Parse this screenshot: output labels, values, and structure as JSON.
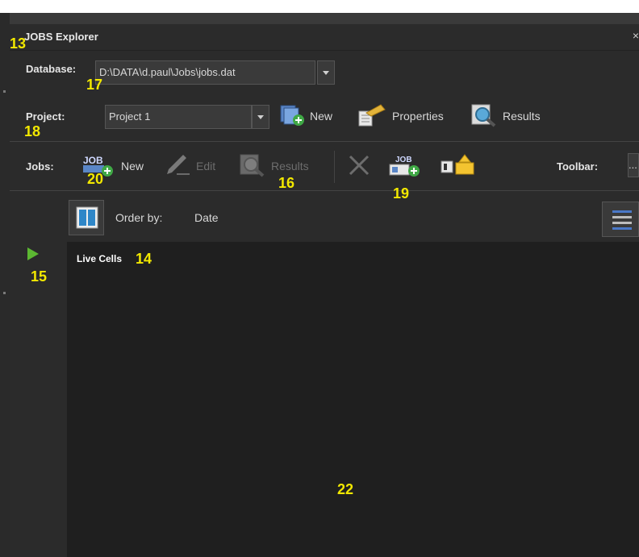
{
  "panel": {
    "title": "JOBS Explorer",
    "close_glyph": "×"
  },
  "database": {
    "label": "Database:",
    "value": "D:\\DATA\\d.paul\\Jobs\\jobs.dat"
  },
  "project": {
    "label": "Project:",
    "value": "Project 1",
    "new_label": "New",
    "properties_label": "Properties",
    "results_label": "Results"
  },
  "jobs": {
    "label": "Jobs:",
    "new_label": "New",
    "edit_label": "Edit",
    "results_label": "Results",
    "toolbar_label": "Toolbar:",
    "toolbar_value": "..."
  },
  "order": {
    "label": "Order by:",
    "value": "Date"
  },
  "tree": {
    "item_label": "Live Cells"
  },
  "annotations": {
    "a13": "13",
    "a17": "17",
    "a18": "18",
    "a20": "20",
    "a16": "16",
    "a19": "19",
    "a15": "15",
    "a14": "14",
    "a22": "22"
  },
  "icons": {
    "new_project": "document-plus-icon",
    "properties": "properties-icon",
    "results": "magnifier-icon",
    "job_new": "job-plus-icon",
    "edit": "pencil-icon",
    "delete": "close-x-icon",
    "job_group_add": "job-group-plus-icon",
    "export": "export-icon",
    "order_toggle": "columns-icon",
    "expand": "play-arrow-icon"
  },
  "colors": {
    "panel_bg": "#2b2b2b",
    "content_bg": "#1f1f1f",
    "annotation": "#f2e800",
    "expand_arrow": "#5cb832"
  }
}
